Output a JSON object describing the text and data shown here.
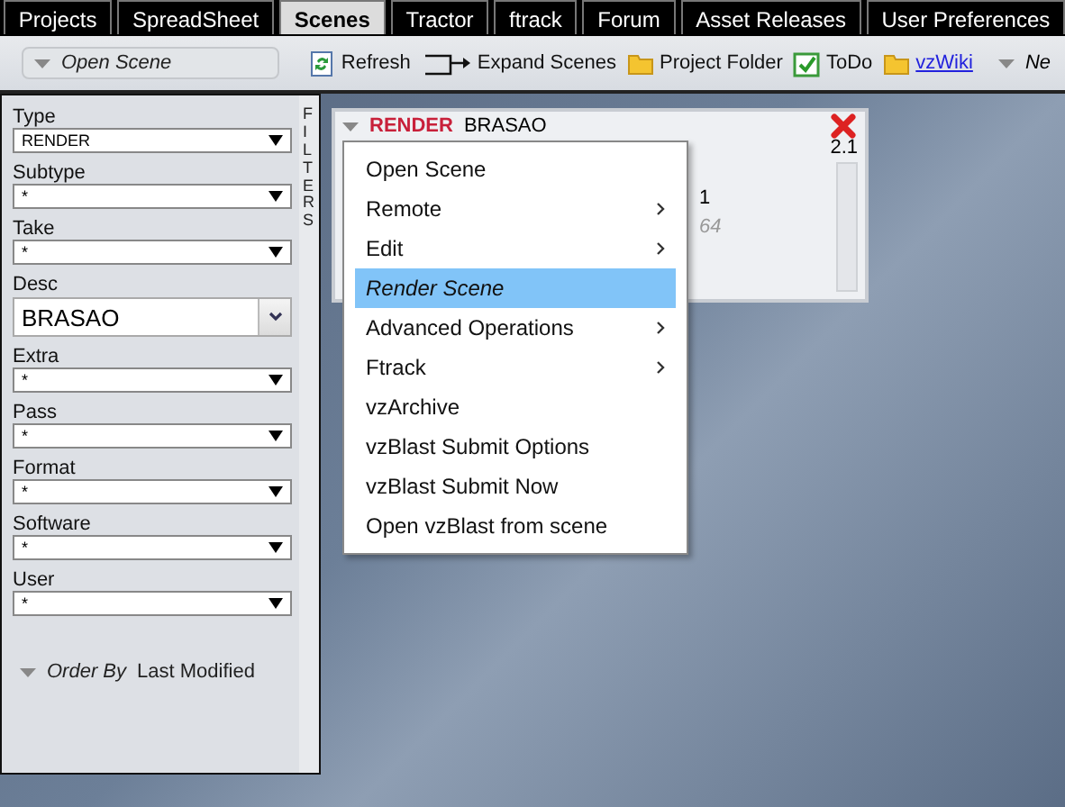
{
  "tabs": [
    {
      "label": "Projects",
      "selected": false
    },
    {
      "label": "SpreadSheet",
      "selected": false
    },
    {
      "label": "Scenes",
      "selected": true
    },
    {
      "label": "Tractor",
      "selected": false
    },
    {
      "label": "ftrack",
      "selected": false
    },
    {
      "label": "Forum",
      "selected": false
    },
    {
      "label": "Asset Releases",
      "selected": false
    },
    {
      "label": "User Preferences",
      "selected": false
    }
  ],
  "toolbar": {
    "scene_menu": "Open Scene",
    "buttons": [
      {
        "label": "Refresh",
        "kind": "refresh"
      },
      {
        "label": "Expand Scenes",
        "kind": "expand"
      },
      {
        "label": "Project Folder",
        "kind": "folder"
      },
      {
        "label": "ToDo",
        "kind": "todo"
      },
      {
        "label": "vzWiki",
        "kind": "link"
      }
    ],
    "cut_menu": "Ne"
  },
  "filters": {
    "title": "FILTERS",
    "fields": [
      {
        "label": "Type",
        "value": "RENDER",
        "kind": "select"
      },
      {
        "label": "Subtype",
        "value": "*",
        "kind": "select"
      },
      {
        "label": "Take",
        "value": "*",
        "kind": "select"
      },
      {
        "label": "Desc",
        "value": "BRASAO",
        "kind": "combo"
      },
      {
        "label": "Extra",
        "value": "*",
        "kind": "select"
      },
      {
        "label": "Pass",
        "value": "*",
        "kind": "select"
      },
      {
        "label": "Format",
        "value": "*",
        "kind": "select"
      },
      {
        "label": "Software",
        "value": "*",
        "kind": "select"
      },
      {
        "label": "User",
        "value": "*",
        "kind": "select"
      }
    ],
    "order_by": {
      "label": "Order By",
      "value": "Last Modified"
    }
  },
  "scene_card": {
    "type": "RENDER",
    "desc": "BRASAO",
    "version": "2.1",
    "field_1": "1",
    "field_2": "64"
  },
  "context_menu": [
    {
      "label": "Open Scene",
      "kind": "action",
      "selected": false
    },
    {
      "label": "Remote",
      "kind": "submenu",
      "selected": false
    },
    {
      "label": "Edit",
      "kind": "submenu",
      "selected": false
    },
    {
      "label": "Render Scene",
      "kind": "action",
      "selected": true
    },
    {
      "label": "Advanced Operations",
      "kind": "submenu",
      "selected": false
    },
    {
      "label": "Ftrack",
      "kind": "submenu",
      "selected": false
    },
    {
      "label": "vzArchive",
      "kind": "action",
      "selected": false
    },
    {
      "label": "vzBlast Submit Options",
      "kind": "action",
      "selected": false
    },
    {
      "label": "vzBlast Submit Now",
      "kind": "action",
      "selected": false
    },
    {
      "label": "Open vzBlast from scene",
      "kind": "action",
      "selected": false
    }
  ]
}
